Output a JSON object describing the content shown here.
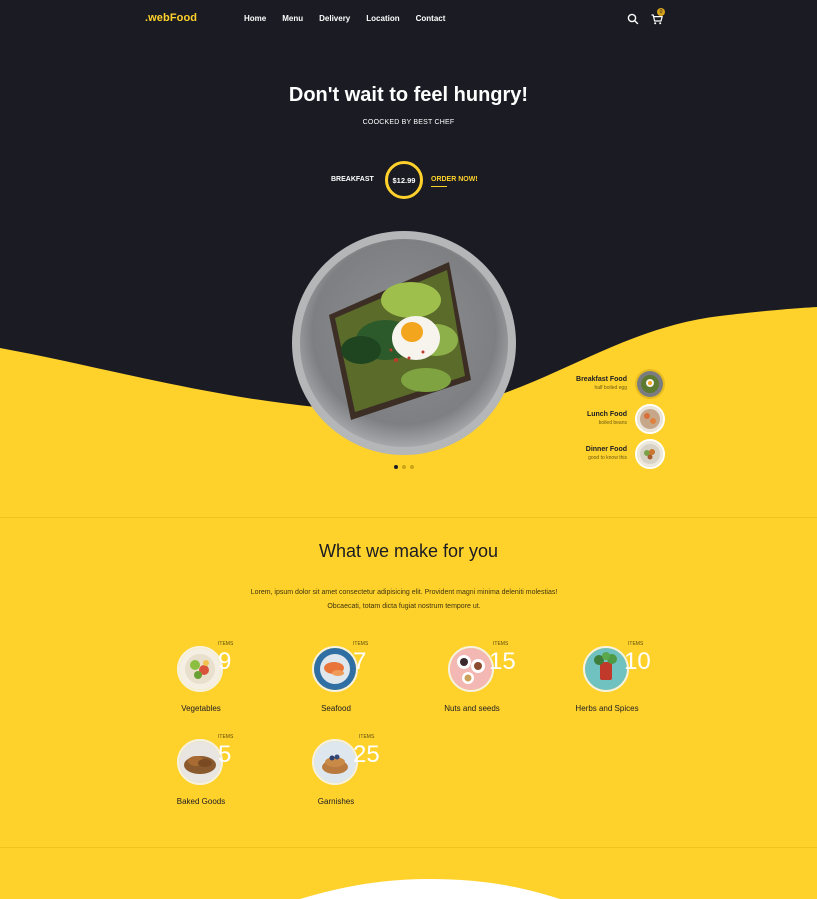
{
  "brand": {
    "logo": ".webFood"
  },
  "nav": {
    "items": [
      "Home",
      "Menu",
      "Delivery",
      "Location",
      "Contact"
    ],
    "cart_count": "0"
  },
  "hero": {
    "headline": "Don't wait to feel hungry!",
    "subhead": "COOCKED BY BEST CHEF",
    "offer_label": "BREAKFAST",
    "price": "$12.99",
    "order_cta": "ORDER NOW!"
  },
  "side_menu": [
    {
      "title": "Breakfast Food",
      "subtitle": "half boiled egg",
      "icon": "egg-toast-thumb"
    },
    {
      "title": "Lunch Food",
      "subtitle": "boiled beans",
      "icon": "shrimp-plate-thumb"
    },
    {
      "title": "Dinner Food",
      "subtitle": "good to know this",
      "icon": "salad-plate-thumb"
    }
  ],
  "slider": {
    "active_index": 0,
    "count": 3
  },
  "section": {
    "title": "What we make for you",
    "text": "Lorem, ipsum dolor sit amet consectetur adipisicing elit. Provident magni minima deleniti molestias! Obcaecati, totam dicta fugiat nostrum tempore ut."
  },
  "categories": [
    {
      "name": "Vegetables",
      "items_label": "ITEMS",
      "count": "9"
    },
    {
      "name": "Seafood",
      "items_label": "ITEMS",
      "count": "7"
    },
    {
      "name": "Nuts and seeds",
      "items_label": "ITEMS",
      "count": "15"
    },
    {
      "name": "Herbs and Spices",
      "items_label": "ITEMS",
      "count": "10"
    },
    {
      "name": "Baked Goods",
      "items_label": "ITEMS",
      "count": "5"
    },
    {
      "name": "Garnishes",
      "items_label": "ITEMS",
      "count": "25"
    }
  ],
  "colors": {
    "dark": "#1b1b24",
    "accent": "#ffd22b",
    "white": "#ffffff"
  }
}
